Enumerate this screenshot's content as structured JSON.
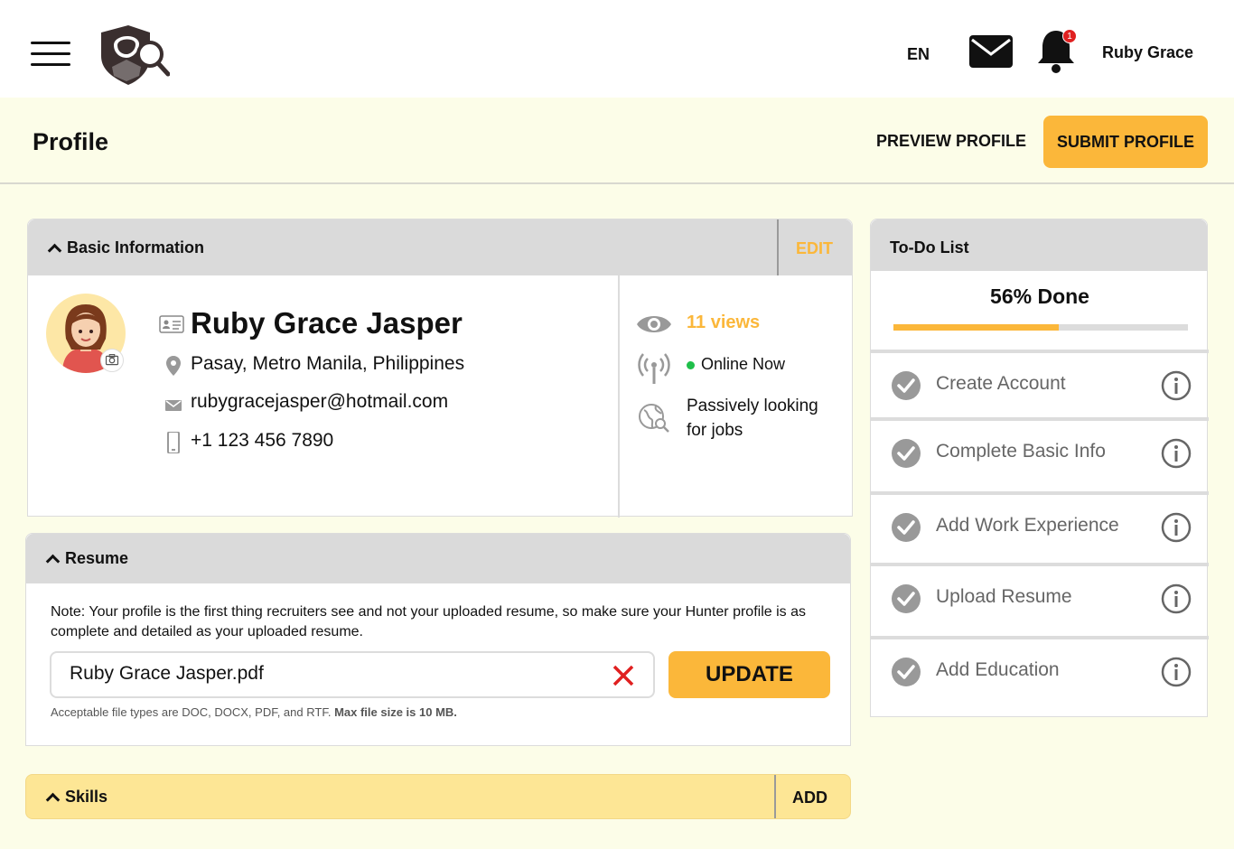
{
  "header": {
    "language": "EN",
    "notification_count": "1",
    "user_name": "Ruby Grace"
  },
  "page": {
    "title": "Profile",
    "preview_label": "PREVIEW PROFILE",
    "submit_label": "SUBMIT PROFILE"
  },
  "basic_info": {
    "title": "Basic Information",
    "edit_label": "EDIT",
    "full_name": "Ruby Grace Jasper",
    "location": "Pasay, Metro Manila, Philippines",
    "email": "rubygracejasper@hotmail.com",
    "phone": "+1 123 456 7890",
    "views": "11 views",
    "status": "Online Now",
    "job_status": "Passively looking for jobs"
  },
  "resume": {
    "title": "Resume",
    "note": "Note: Your profile is the first thing recruiters see and not your uploaded resume, so make sure your Hunter profile is as complete and detailed as your uploaded resume.",
    "file_name": "Ruby Grace Jasper.pdf",
    "update_label": "UPDATE",
    "file_types": "Acceptable file types are DOC, DOCX, PDF, and RTF.",
    "max_size": "Max file size is 10 MB."
  },
  "skills": {
    "title": "Skills",
    "add_label": "ADD"
  },
  "todo": {
    "title": "To-Do List",
    "progress_label": "56% Done",
    "progress_percent": 56,
    "items": [
      {
        "label": "Create Account",
        "done": true
      },
      {
        "label": "Complete Basic Info",
        "done": true
      },
      {
        "label": "Add Work Experience",
        "done": true
      },
      {
        "label": "Upload Resume",
        "done": true
      },
      {
        "label": "Add Education",
        "done": true
      }
    ]
  },
  "colors": {
    "accent": "#fbb73a",
    "page_bg": "#fcfde8",
    "card_header": "#dadada",
    "skills_bg": "#fde695",
    "online": "#1fbf4a",
    "remove": "#e02020"
  }
}
